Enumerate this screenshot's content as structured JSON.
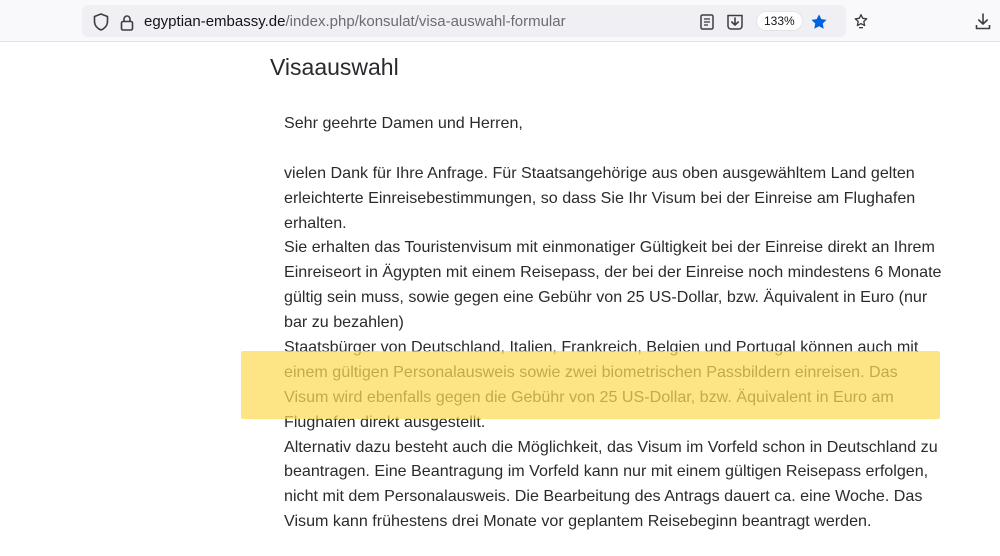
{
  "browser": {
    "url_host": "egyptian-embassy.de",
    "url_path": "/index.php/konsulat/visa-auswahl-formular",
    "zoom": "133%"
  },
  "page": {
    "title": "Visaauswahl",
    "greeting": "Sehr geehrte Damen und Herren,",
    "lines": [
      "vielen Dank für Ihre Anfrage. Für Staatsangehörige aus oben ausgewähltem Land gelten",
      "erleichterte Einreisebestimmungen, so dass Sie Ihr Visum bei der Einreise am Flughafen",
      "erhalten.",
      "Sie erhalten das Touristenvisum mit einmonatiger Gültigkeit bei der Einreise direkt an Ihrem",
      "Einreiseort in Ägypten mit einem Reisepass, der bei der Einreise noch mindestens 6 Monate",
      "gültig sein muss, sowie gegen eine Gebühr von 25 US-Dollar, bzw. Äquivalent in Euro (nur",
      "bar zu bezahlen)",
      "Staatsbürger von Deutschland, Italien, Frankreich, Belgien und Portugal können auch mit",
      "einem gültigen Personalausweis sowie zwei biometrischen Passbildern einreisen. Das",
      "Visum wird ebenfalls gegen die Gebühr von 25 US-Dollar, bzw. Äquivalent in Euro am",
      "Flughafen direkt ausgestellt.",
      "Alternativ dazu besteht auch die Möglichkeit, das Visum im Vorfeld schon in Deutschland zu",
      "beantragen. Eine Beantragung im Vorfeld kann nur mit einem gültigen Reisepass erfolgen,",
      "nicht mit dem Personalausweis. Die Bearbeitung des Antrags dauert ca. eine Woche. Das",
      "Visum kann frühestens drei Monate vor geplantem Reisebeginn beantragt werden."
    ]
  },
  "colors": {
    "highlight": "#fcd954",
    "bookmark_star": "#0061e0"
  }
}
